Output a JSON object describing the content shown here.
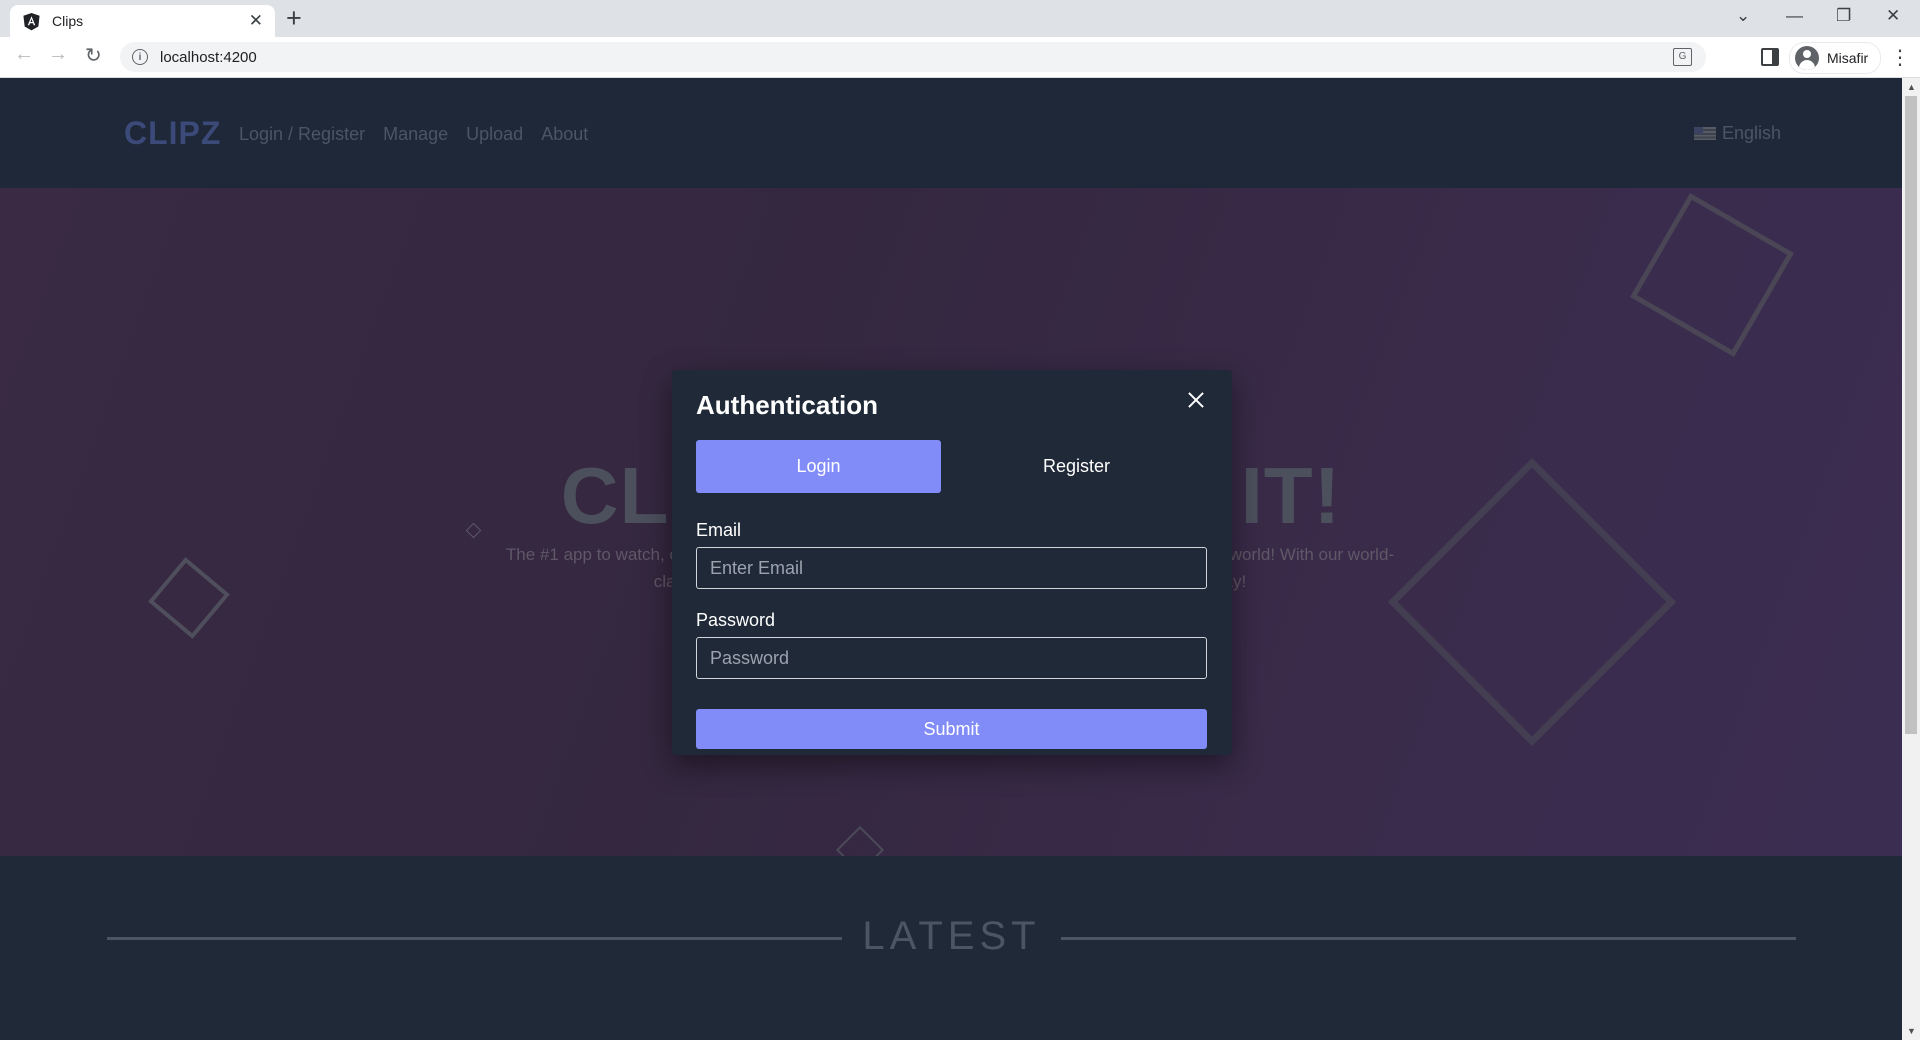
{
  "browser": {
    "tab_title": "Clips",
    "url": "localhost:4200",
    "profile_name": "Misafir"
  },
  "site": {
    "brand": "CLIPZ",
    "nav": [
      "Login / Register",
      "Manage",
      "Upload",
      "About"
    ],
    "language": "English"
  },
  "hero": {
    "title_left": "CLI",
    "title_right": "IT!",
    "subtitle_line1_left": "The #1 app to watch, cl",
    "subtitle_line1_right": "world! With our world-",
    "subtitle_line2_left": "cla",
    "subtitle_line2_right": "ay!"
  },
  "latest": {
    "title": "LATEST"
  },
  "modal": {
    "title": "Authentication",
    "tabs": {
      "login": "Login",
      "register": "Register"
    },
    "email_label": "Email",
    "email_placeholder": "Enter Email",
    "password_label": "Password",
    "password_placeholder": "Password",
    "submit": "Submit"
  },
  "colors": {
    "accent": "#818cf8",
    "header_bg": "#1e2838",
    "modal_bg": "#1f2937"
  }
}
